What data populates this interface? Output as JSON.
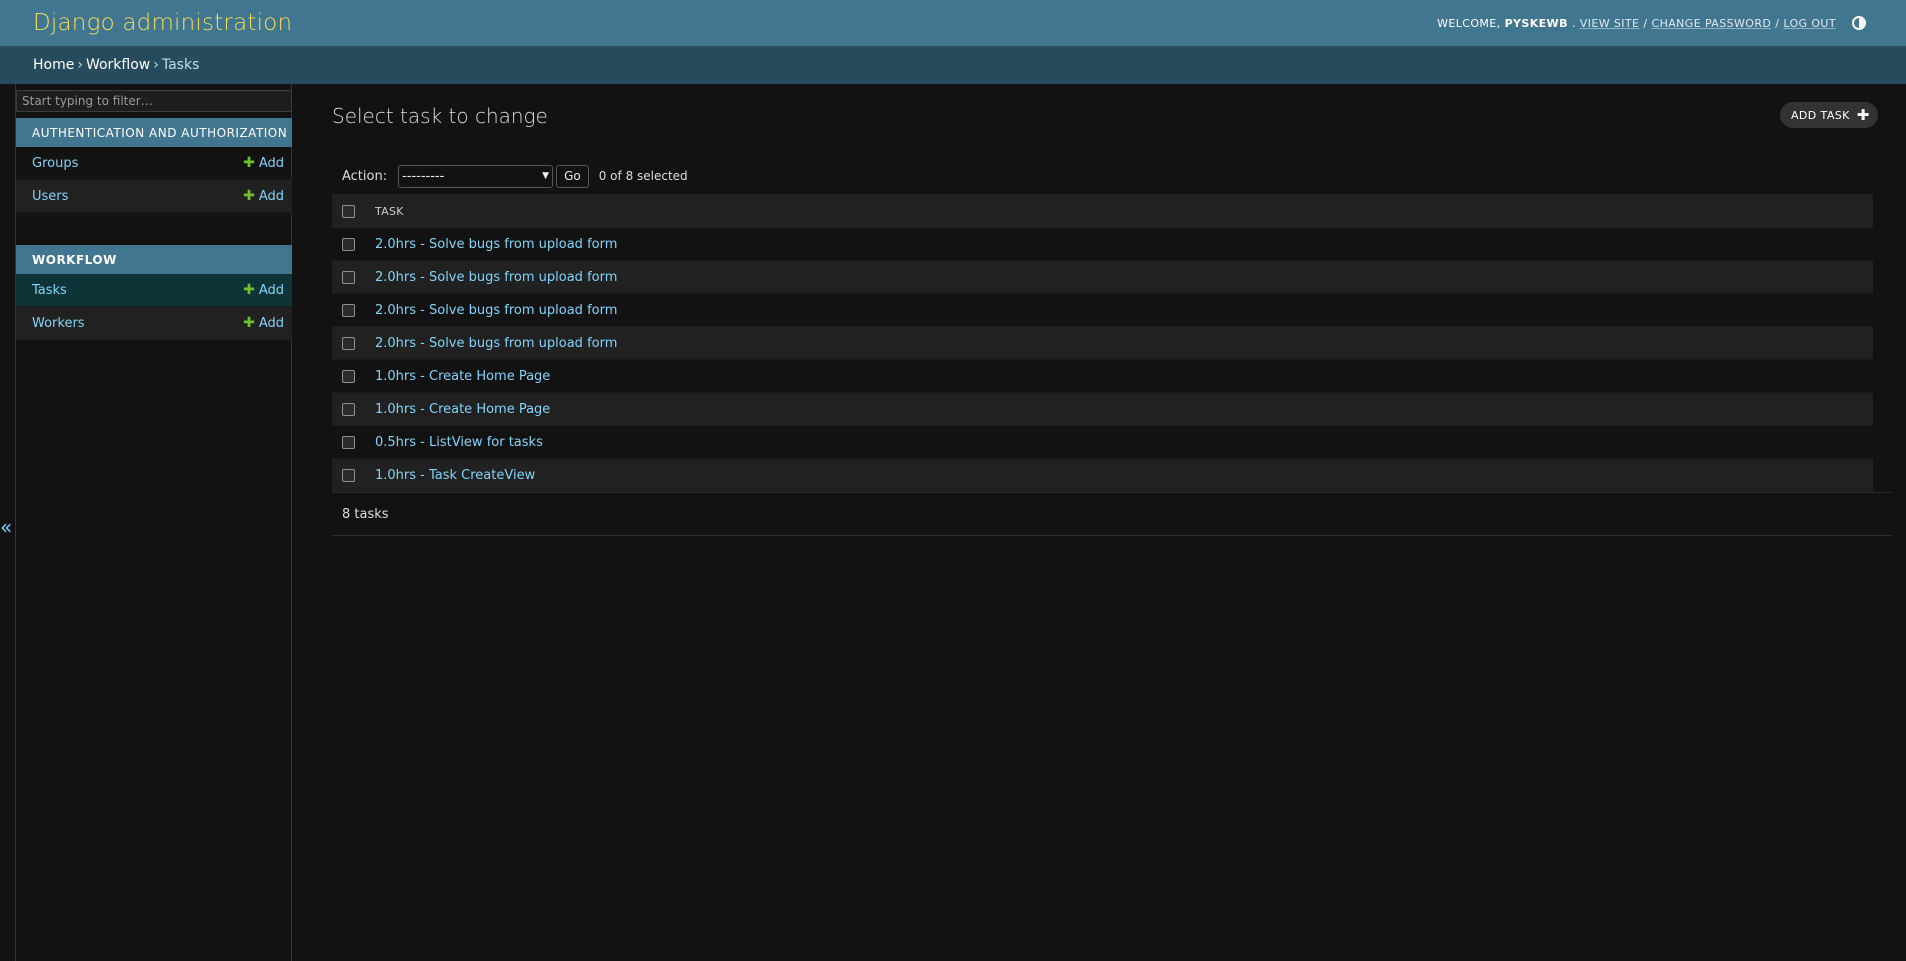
{
  "header": {
    "branding": "Django administration",
    "welcome": "Welcome,",
    "username": "pyskewb",
    "view_site": "View site",
    "change_password": "Change password",
    "log_out": "Log out",
    "sep": "/",
    "theme_toggle_icon": "half-circle-icon"
  },
  "breadcrumbs": {
    "home": "Home",
    "app": "Workflow",
    "current": "Tasks",
    "separator": "›"
  },
  "sidebar": {
    "filter_placeholder": "Start typing to filter…",
    "add_label": "Add",
    "apps": [
      {
        "caption": "Authentication and Authorization",
        "models": [
          {
            "name": "Groups"
          },
          {
            "name": "Users"
          }
        ]
      },
      {
        "caption": "Workflow",
        "models": [
          {
            "name": "Tasks"
          },
          {
            "name": "Workers"
          }
        ]
      }
    ],
    "collapse_icon": "«"
  },
  "content": {
    "title": "Select task to change",
    "add_button": "Add task",
    "action_label": "Action:",
    "action_selected": "---------",
    "go_label": "Go",
    "selection_count": "0 of 8 selected",
    "column_header": "Task",
    "rows": [
      "2.0hrs - Solve bugs from upload form",
      "2.0hrs - Solve bugs from upload form",
      "2.0hrs - Solve bugs from upload form",
      "2.0hrs - Solve bugs from upload form",
      "1.0hrs - Create Home Page",
      "1.0hrs - Create Home Page",
      "0.5hrs - ListView for tasks",
      "1.0hrs - Task CreateView"
    ],
    "paginator": "8 tasks"
  },
  "colors": {
    "header": "#417690",
    "branding": "#f5dd5d",
    "breadcrumbs": "#264b5d",
    "link": "#81d4fa",
    "add_plus": "#70bf2b",
    "background": "#121212"
  }
}
